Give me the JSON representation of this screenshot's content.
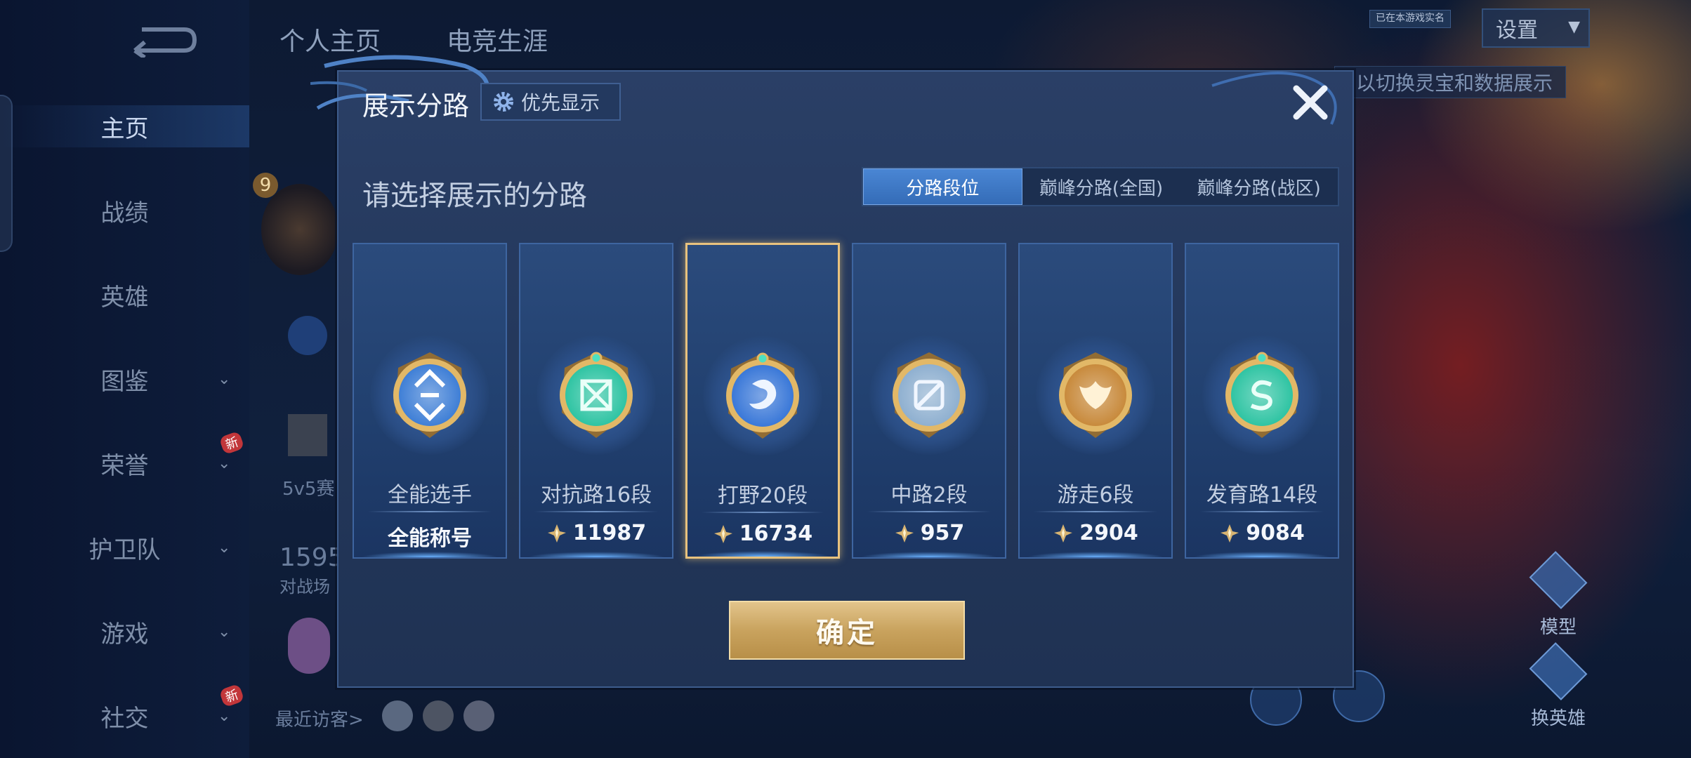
{
  "top_tabs": [
    "个人主页",
    "电竞生涯"
  ],
  "sidebar": {
    "items": [
      {
        "label": "主页",
        "chevron": false,
        "new": false
      },
      {
        "label": "战绩",
        "chevron": false,
        "new": false
      },
      {
        "label": "英雄",
        "chevron": false,
        "new": false
      },
      {
        "label": "图鉴",
        "chevron": true,
        "new": false
      },
      {
        "label": "荣誉",
        "chevron": true,
        "new": true
      },
      {
        "label": "护卫队",
        "chevron": true,
        "new": false
      },
      {
        "label": "游戏",
        "chevron": true,
        "new": false
      },
      {
        "label": "社交",
        "chevron": true,
        "new": true
      }
    ],
    "new_badge": "新"
  },
  "background": {
    "level": "9",
    "mode_text": "5v5赛",
    "number": "1595",
    "battle_text": "对战场",
    "recent_visitors": "最近访客>",
    "tip": "以切换灵宝和数据展示",
    "badge": "已在本游戏实名",
    "settings": "设置",
    "model": "模型",
    "switch_hero": "换英雄"
  },
  "modal": {
    "title": "展示分路",
    "priority_button": "优先显示",
    "subtitle": "请选择展示的分路",
    "tabs": [
      {
        "label": "分路段位",
        "active": true
      },
      {
        "label": "巅峰分路(全国)",
        "active": false
      },
      {
        "label": "巅峰分路(战区)",
        "active": false
      }
    ],
    "cards": [
      {
        "name": "全能选手",
        "value": "全能称号",
        "score_icon": false,
        "selected": false,
        "emblem": "all-round",
        "color": "#3f7fd6"
      },
      {
        "name": "对抗路16段",
        "value": "11987",
        "score_icon": true,
        "selected": false,
        "emblem": "clash-lane",
        "color": "#2fc4a3"
      },
      {
        "name": "打野20段",
        "value": "16734",
        "score_icon": true,
        "selected": true,
        "emblem": "jungle",
        "color": "#3a78d8"
      },
      {
        "name": "中路2段",
        "value": "957",
        "score_icon": true,
        "selected": false,
        "emblem": "mid-lane",
        "color": "#8fb0d0"
      },
      {
        "name": "游走6段",
        "value": "2904",
        "score_icon": true,
        "selected": false,
        "emblem": "roam",
        "color": "#c88a3c"
      },
      {
        "name": "发育路14段",
        "value": "9084",
        "score_icon": true,
        "selected": false,
        "emblem": "farm-lane",
        "color": "#2fc4a3"
      }
    ],
    "confirm": "确定"
  }
}
